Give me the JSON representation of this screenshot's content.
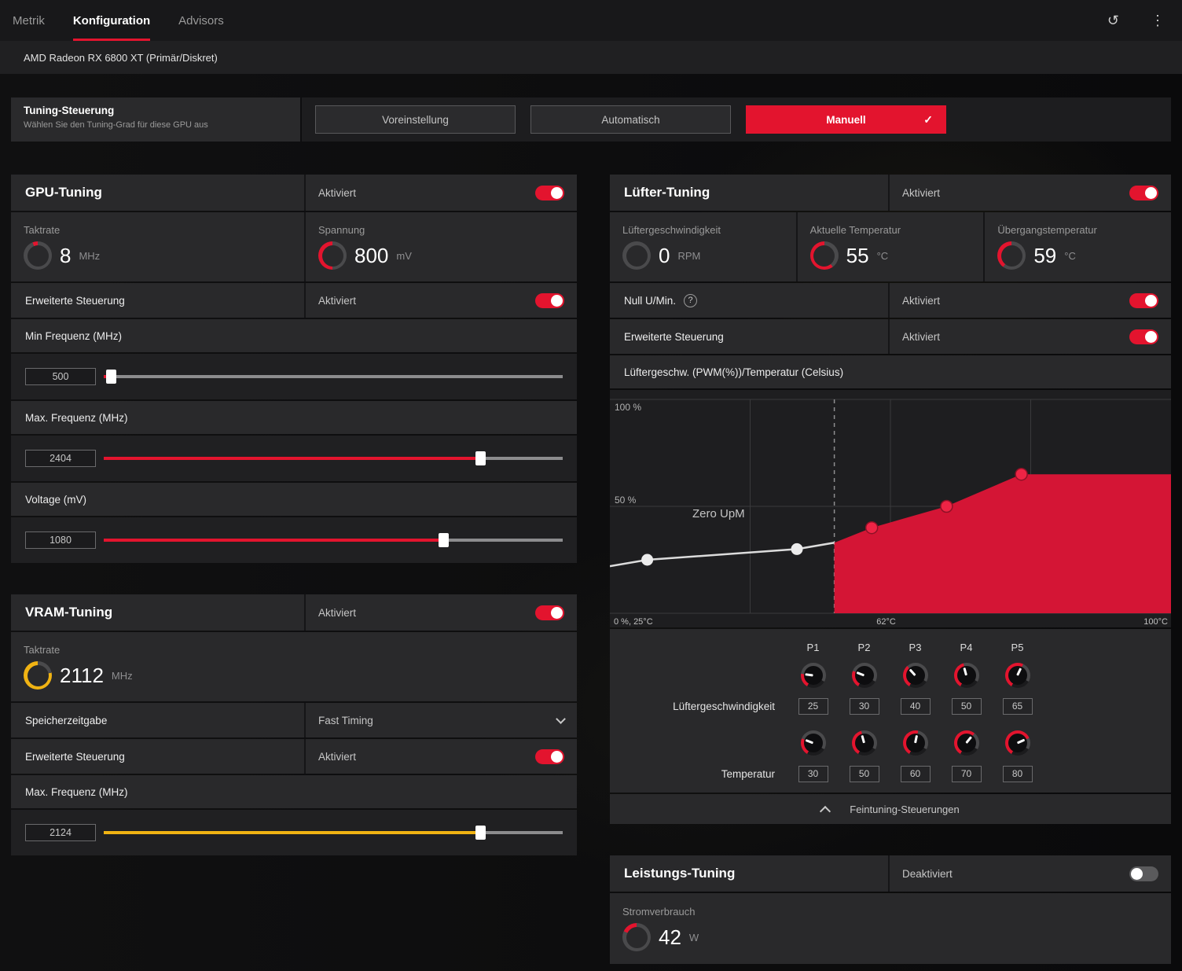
{
  "nav": {
    "tabs": [
      {
        "label": "Metrik",
        "active": false
      },
      {
        "label": "Konfiguration",
        "active": true
      },
      {
        "label": "Advisors",
        "active": false
      }
    ],
    "reset_icon": "↺",
    "menu_icon": "⋮"
  },
  "device_bar": {
    "gpu_name": "AMD Radeon RX 6800 XT (Primär/Diskret)"
  },
  "tuning_control": {
    "title": "Tuning-Steuerung",
    "subtitle": "Wählen Sie den Tuning-Grad für diese GPU aus",
    "options": [
      {
        "label": "Voreinstellung",
        "selected": false
      },
      {
        "label": "Automatisch",
        "selected": false
      },
      {
        "label": "Manuell",
        "selected": true
      }
    ],
    "check_icon": "✓"
  },
  "gpu_tuning": {
    "title": "GPU-Tuning",
    "status": "Aktiviert",
    "enabled": true,
    "stats": [
      {
        "label": "Taktrate",
        "value": "8",
        "unit": "MHz",
        "gauge": {
          "percent": 6,
          "color": "#e3142e"
        }
      },
      {
        "label": "Spannung",
        "value": "800",
        "unit": "mV",
        "gauge": {
          "percent": 50,
          "color": "#e3142e"
        }
      }
    ],
    "advanced": {
      "label": "Erweiterte Steuerung",
      "status": "Aktiviert",
      "enabled": true
    },
    "sliders": [
      {
        "label": "Min Frequenz (MHz)",
        "value": "500",
        "percent": 1.5,
        "color": "#e3142e"
      },
      {
        "label": "Max. Frequenz (MHz)",
        "value": "2404",
        "percent": 82,
        "color": "#e3142e"
      },
      {
        "label": "Voltage (mV)",
        "value": "1080",
        "percent": 74,
        "color": "#e3142e"
      }
    ]
  },
  "vram_tuning": {
    "title": "VRAM-Tuning",
    "status": "Aktiviert",
    "enabled": true,
    "stat": {
      "label": "Taktrate",
      "value": "2112",
      "unit": "MHz",
      "gauge": {
        "percent": 78,
        "color": "#f0b313"
      }
    },
    "timing": {
      "label": "Speicherzeitgabe",
      "value": "Fast Timing"
    },
    "advanced": {
      "label": "Erweiterte Steuerung",
      "status": "Aktiviert",
      "enabled": true
    },
    "sliders": [
      {
        "label": "Max. Frequenz (MHz)",
        "value": "2124",
        "percent": 82,
        "color": "#f0b313"
      }
    ]
  },
  "fan_tuning": {
    "title": "Lüfter-Tuning",
    "status": "Aktiviert",
    "enabled": true,
    "stats": [
      {
        "label": "Lüftergeschwindigkeit",
        "value": "0",
        "unit": "RPM",
        "gauge": {
          "percent": 0,
          "color": "#e3142e"
        }
      },
      {
        "label": "Aktuelle Temperatur",
        "value": "55",
        "unit": "°C",
        "gauge": {
          "percent": 60,
          "color": "#e3142e"
        }
      },
      {
        "label": "Übergangstemperatur",
        "value": "59",
        "unit": "°C",
        "gauge": {
          "percent": 40,
          "color": "#e3142e"
        }
      }
    ],
    "zero_rpm": {
      "label": "Null U/Min.",
      "help_icon": "?",
      "status": "Aktiviert",
      "enabled": true
    },
    "advanced": {
      "label": "Erweiterte Steuerung",
      "status": "Aktiviert",
      "enabled": true
    },
    "chart_header": "Lüftergeschw. (PWM(%))/Temperatur (Celsius)",
    "curve_editor": {
      "point_labels": [
        "P1",
        "P2",
        "P3",
        "P4",
        "P5"
      ],
      "speed_row_label": "Lüftergeschwindigkeit",
      "temp_row_label": "Temperatur",
      "speeds": [
        25,
        30,
        40,
        50,
        65
      ],
      "temps": [
        30,
        50,
        60,
        70,
        80
      ]
    },
    "fine_tuning_label": "Feintuning-Steuerungen"
  },
  "power_tuning": {
    "title": "Leistungs-Tuning",
    "status": "Deaktiviert",
    "enabled": false,
    "stat": {
      "label": "Stromverbrauch",
      "value": "42",
      "unit": "W",
      "gauge": {
        "percent": 18,
        "color": "#e3142e"
      }
    }
  },
  "chart_data": {
    "type": "area",
    "title": "Lüftergeschw. (PWM(%))/Temperatur (Celsius)",
    "xlabel": "Temperatur (Celsius)",
    "ylabel": "Lüftergeschw. (PWM %)",
    "x_range": [
      25,
      100
    ],
    "y_range": [
      0,
      100
    ],
    "x_tick_labels": [
      "0 %, 25°C",
      "62°C",
      "100°C"
    ],
    "y_tick_labels": [
      "100 %",
      "50 %"
    ],
    "zero_rpm_label": "Zero UpM",
    "zero_rpm_boundary_temp": 55,
    "grid": true,
    "series": [
      {
        "name": "zero-rpm-line",
        "type": "line",
        "color": "#dcdcdc",
        "points": [
          [
            25,
            22
          ],
          [
            30,
            25
          ],
          [
            50,
            30
          ],
          [
            55,
            33
          ]
        ]
      },
      {
        "name": "fan-curve-area",
        "type": "area",
        "color": "#d41535",
        "points": [
          [
            55,
            33
          ],
          [
            60,
            40
          ],
          [
            70,
            50
          ],
          [
            80,
            65
          ],
          [
            100,
            65
          ]
        ]
      }
    ],
    "markers": {
      "white": [
        [
          30,
          25
        ],
        [
          50,
          30
        ]
      ],
      "red": [
        [
          60,
          40
        ],
        [
          70,
          50
        ],
        [
          80,
          65
        ]
      ]
    }
  },
  "colors": {
    "accent": "#e3142e",
    "vram_accent": "#f0b313",
    "area_red": "#d41535"
  }
}
